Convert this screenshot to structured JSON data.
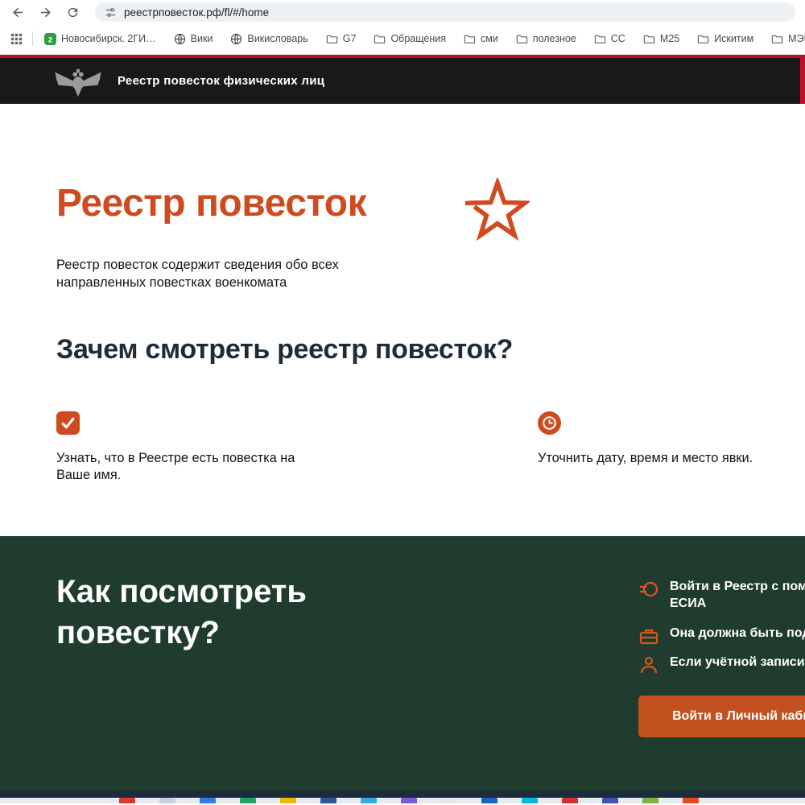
{
  "browser": {
    "url": "реестрповесток.рф/fl/#/home",
    "bookmarks": [
      {
        "label": "Новосибирск. 2ГИ…",
        "icon": "2gis-icon"
      },
      {
        "label": "Вики",
        "icon": "globe-icon"
      },
      {
        "label": "Викисловарь",
        "icon": "globe-icon"
      },
      {
        "label": "G7",
        "icon": "folder-icon"
      },
      {
        "label": "Обращения",
        "icon": "folder-icon"
      },
      {
        "label": "сми",
        "icon": "folder-icon"
      },
      {
        "label": "полезное",
        "icon": "folder-icon"
      },
      {
        "label": "СС",
        "icon": "folder-icon"
      },
      {
        "label": "М25",
        "icon": "folder-icon"
      },
      {
        "label": "Искитим",
        "icon": "folder-icon"
      },
      {
        "label": "МЭРИЯ",
        "icon": "folder-icon"
      }
    ]
  },
  "site": {
    "header": {
      "title": "Реестр повесток физических лиц"
    },
    "hero": {
      "title": "Реестр повесток",
      "description": "Реестр повесток содержит сведения обо всех направленных повестках военкомата"
    },
    "why": {
      "title": "Зачем смотреть реестр повесток?",
      "items": [
        {
          "icon": "checkbox-icon",
          "text": "Узнать, что в Реестре есть повестка на Ваше имя."
        },
        {
          "icon": "clock-icon",
          "text": "Уточнить дату, время и место явки."
        }
      ]
    },
    "how": {
      "title_line1": "Как посмотреть",
      "title_line2": "повестку?",
      "steps": [
        {
          "icon": "esia-login-icon",
          "line1": "Войти в Реестр с пом",
          "line2": "ЕСИА"
        },
        {
          "icon": "briefcase-icon",
          "line1": "Она должна быть под",
          "line2": ""
        },
        {
          "icon": "person-icon",
          "line1": "Если учётной записи",
          "line2": ""
        }
      ],
      "button_label": "Войти в Личный каби"
    }
  },
  "colors": {
    "accent_orange": "#d04a1f",
    "button_orange": "#c2511f",
    "header_bg": "#191919",
    "green_bg": "#1f3c2e",
    "top_line_red": "#b11226",
    "footer_navy": "#1c2b3d",
    "heading_dark": "#1e2b39"
  },
  "taskbar": {
    "icons": [
      {
        "name": "taskbar-app",
        "color": "#d93b30"
      },
      {
        "name": "taskbar-app",
        "color": "#c8d0da"
      },
      {
        "name": "taskbar-app",
        "color": "#2f7de1"
      },
      {
        "name": "taskbar-app",
        "color": "#1fa463"
      },
      {
        "name": "taskbar-app",
        "color": "#f2b705"
      },
      {
        "name": "taskbar-app",
        "color": "#2b5797"
      },
      {
        "name": "taskbar-app",
        "color": "#33aadd"
      },
      {
        "name": "taskbar-app",
        "color": "#7b5cd6"
      },
      {
        "name": "taskbar-app",
        "color": "#e3e8ee"
      },
      {
        "name": "taskbar-app",
        "color": "#1565c0"
      },
      {
        "name": "taskbar-app",
        "color": "#00bcd4"
      },
      {
        "name": "taskbar-app",
        "color": "#d32f2f"
      },
      {
        "name": "taskbar-app",
        "color": "#3f51b5"
      },
      {
        "name": "taskbar-app",
        "color": "#7cb342"
      },
      {
        "name": "taskbar-app",
        "color": "#e64a19"
      }
    ]
  }
}
